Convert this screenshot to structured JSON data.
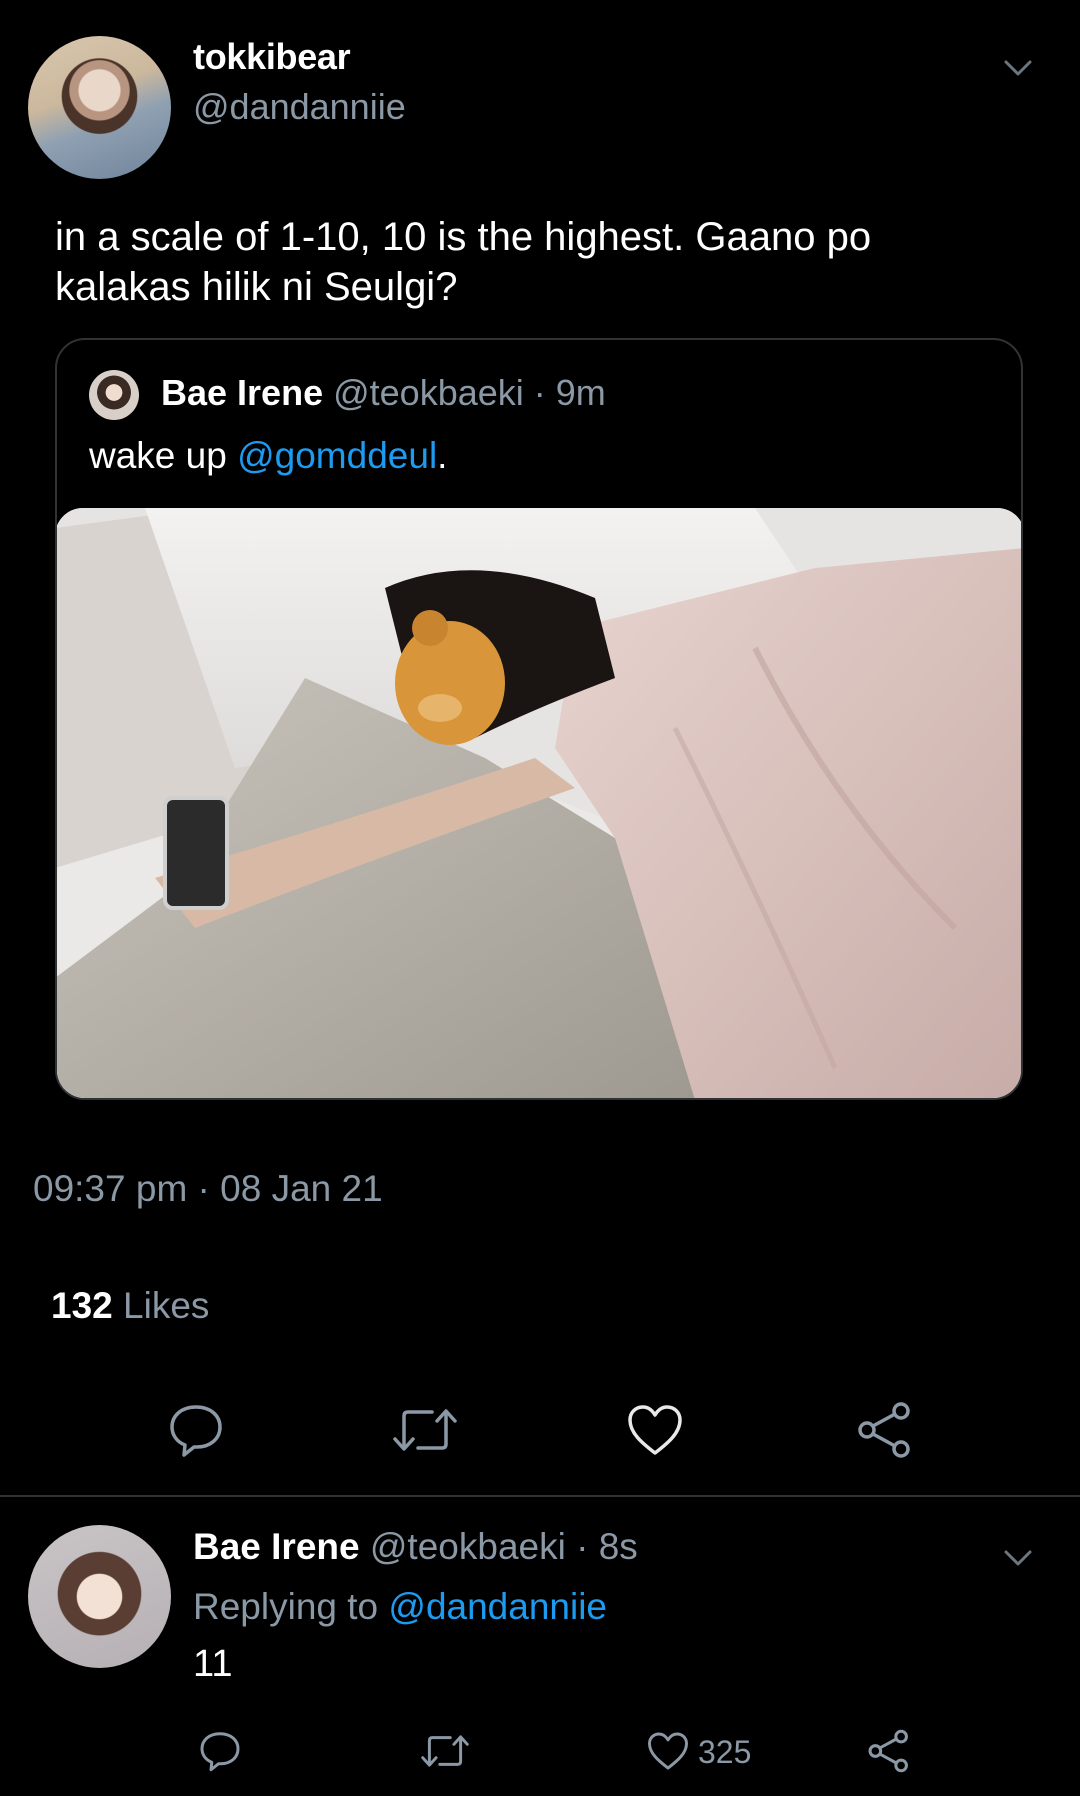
{
  "tweet": {
    "display_name": "tokkibear",
    "handle": "@dandanniie",
    "text": "in a scale of 1-10, 10 is the highest. Gaano po kalakas hilik ni Seulgi?",
    "timestamp": "09:37 pm · 08 Jan 21",
    "likes_count": "132",
    "likes_label": "Likes"
  },
  "quote": {
    "display_name": "Bae Irene",
    "handle": "@teokbaeki",
    "time": "· 9m",
    "text_prefix": "wake up ",
    "mention": "@gomddeul",
    "text_suffix": "."
  },
  "actions": {
    "reply_icon": "reply-icon",
    "retweet_icon": "retweet-icon",
    "like_icon": "heart-icon",
    "share_icon": "share-icon"
  },
  "reply": {
    "display_name": "Bae Irene",
    "handle": "@teokbaeki",
    "time": "· 8s",
    "replying_to_label": "Replying to",
    "replying_to_handle": "@dandanniie",
    "text": "11",
    "like_count": "325"
  },
  "colors": {
    "background": "#000000",
    "link": "#1d9bf0",
    "muted": "#8b98a5",
    "divider": "#2f3336"
  }
}
